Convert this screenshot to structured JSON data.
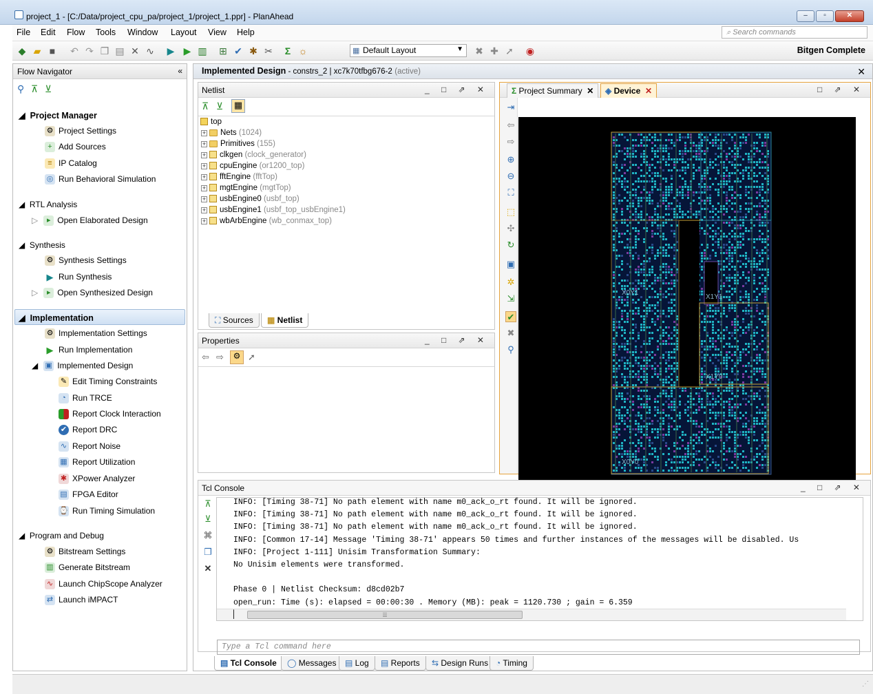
{
  "window": {
    "title": "project_1 - [C:/Data/project_cpu_pa/project_1/project_1.ppr] - PlanAhead",
    "controls": [
      "–",
      "▫",
      "✕"
    ]
  },
  "menu": [
    "File",
    "Edit",
    "Flow",
    "Tools",
    "Window",
    "Layout",
    "View",
    "Help"
  ],
  "search": {
    "placeholder": "Search commands"
  },
  "toolbar": {
    "layout_value": "Default Layout",
    "status": "Bitgen Complete"
  },
  "flow_nav": {
    "title": "Flow Navigator",
    "collapse": "«",
    "sections": [
      {
        "label": "Project Manager",
        "items": [
          "Project Settings",
          "Add Sources",
          "IP Catalog",
          "Run Behavioral Simulation"
        ]
      },
      {
        "label": "RTL Analysis",
        "items": [
          "Open Elaborated Design"
        ]
      },
      {
        "label": "Synthesis",
        "items": [
          "Synthesis Settings",
          "Run Synthesis",
          "Open Synthesized Design"
        ]
      },
      {
        "label": "Implementation",
        "items": [
          "Implementation Settings",
          "Run Implementation",
          "Implemented Design"
        ]
      },
      {
        "label": "Implemented Design",
        "items": [
          "Edit Timing Constraints",
          "Run TRCE",
          "Report Clock Interaction",
          "Report DRC",
          "Report Noise",
          "Report Utilization",
          "XPower Analyzer",
          "FPGA Editor",
          "Run Timing Simulation"
        ]
      },
      {
        "label": "Program and Debug",
        "items": [
          "Bitstream Settings",
          "Generate Bitstream",
          "Launch ChipScope Analyzer",
          "Launch iMPACT"
        ]
      }
    ]
  },
  "impl_header": {
    "title": "Implemented Design",
    "sub": " - constrs_2 | xc7k70tfbg676-2",
    "active": "(active)",
    "close": "✕"
  },
  "netlist": {
    "title": "Netlist",
    "root": "top",
    "nodes": [
      {
        "name": "Nets",
        "detail": "(1024)"
      },
      {
        "name": "Primitives",
        "detail": "(155)"
      },
      {
        "name": "clkgen",
        "detail": "(clock_generator)"
      },
      {
        "name": "cpuEngine",
        "detail": "(or1200_top)"
      },
      {
        "name": "fftEngine",
        "detail": "(fftTop)"
      },
      {
        "name": "mgtEngine",
        "detail": "(mgtTop)"
      },
      {
        "name": "usbEngine0",
        "detail": "(usbf_top)"
      },
      {
        "name": "usbEngine1",
        "detail": "(usbf_top_usbEngine1)"
      },
      {
        "name": "wbArbEngine",
        "detail": "(wb_conmax_top)"
      }
    ],
    "tabs": [
      "Sources",
      "Netlist"
    ]
  },
  "properties": {
    "title": "Properties"
  },
  "device_view": {
    "tabs": [
      "Project Summary",
      "Device"
    ],
    "accent": "#1fb4c4",
    "clock_regions": [
      "X0Y1",
      "X1Y1",
      "X0Y0",
      "X1Y0"
    ]
  },
  "tcl": {
    "title": "Tcl Console",
    "lines": [
      "INFO: [Timing 38-71] No path element with name m0_ack_o_rt found. It will be ignored.",
      "INFO: [Timing 38-71] No path element with name m0_ack_o_rt found. It will be ignored.",
      "INFO: [Timing 38-71] No path element with name m0_ack_o_rt found. It will be ignored.",
      "INFO: [Common 17-14] Message 'Timing 38-71' appears 50 times and further instances of the messages will be disabled. Us",
      "INFO: [Project 1-111] Unisim Transformation Summary:",
      "No Unisim elements were transformed.",
      "",
      "Phase 0 | Netlist Checksum: d8cd02b7",
      "open_run: Time (s): elapsed = 00:00:30 . Memory (MB): peak = 1120.730 ; gain = 6.359"
    ],
    "input_placeholder": "Type a Tcl command here",
    "tabs": [
      "Tcl Console",
      "Messages",
      "Log",
      "Reports",
      "Design Runs",
      "Timing"
    ]
  }
}
